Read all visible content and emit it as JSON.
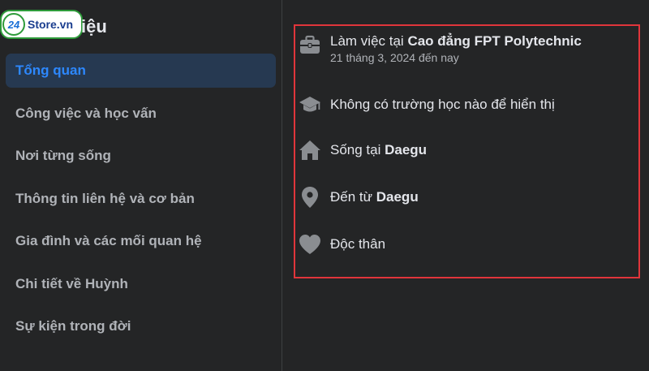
{
  "header": {
    "title_suffix": "iệu",
    "logo": {
      "badge": "24",
      "text": "Store.vn",
      "colors": {
        "border": "#2e9b3a",
        "badge_text": "#1a6fd6",
        "text": "#1a3d8f"
      }
    }
  },
  "sidebar": {
    "items": [
      {
        "label": "Tổng quan",
        "active": true
      },
      {
        "label": "Công việc và học vấn",
        "active": false
      },
      {
        "label": "Nơi từng sống",
        "active": false
      },
      {
        "label": "Thông tin liên hệ và cơ bản",
        "active": false
      },
      {
        "label": "Gia đình và các mối quan hệ",
        "active": false
      },
      {
        "label": "Chi tiết về Huỳnh",
        "active": false
      },
      {
        "label": "Sự kiện trong đời",
        "active": false
      }
    ]
  },
  "overview": {
    "work": {
      "prefix": "Làm việc tại ",
      "place": "Cao đẳng FPT Polytechnic",
      "date": "21 tháng 3, 2024 đến nay",
      "icon": "briefcase-icon"
    },
    "school": {
      "text": "Không có trường học nào để hiển thị",
      "icon": "graduation-cap-icon"
    },
    "lives": {
      "prefix": "Sống tại ",
      "place": "Daegu",
      "icon": "home-icon"
    },
    "from": {
      "prefix": "Đến từ ",
      "place": "Daegu",
      "icon": "location-pin-icon"
    },
    "relationship": {
      "text": "Độc thân",
      "icon": "heart-icon"
    }
  },
  "colors": {
    "background": "#242526",
    "active_bg": "#263951",
    "active_text": "#2d88ff",
    "highlight_border": "#e0353b",
    "icon": "#8a8d91"
  }
}
